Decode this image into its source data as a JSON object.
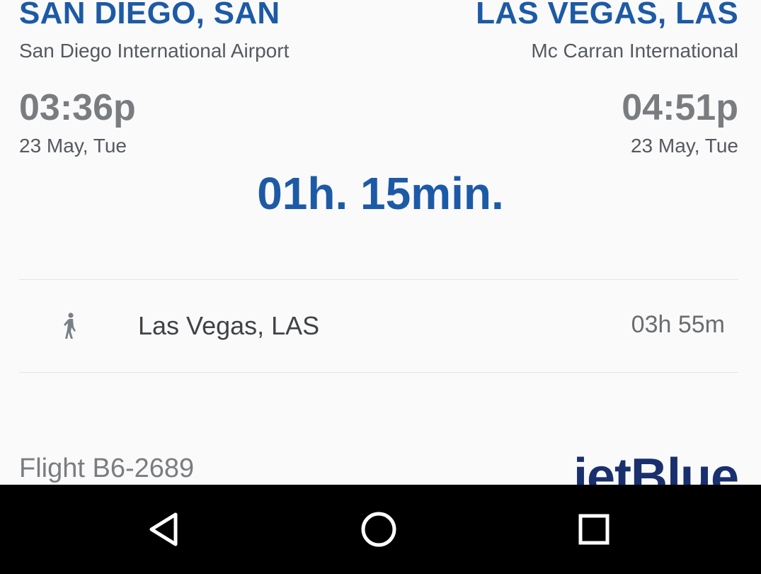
{
  "origin": {
    "city": "SAN DIEGO, SAN",
    "airport": "San Diego International Airport",
    "time": "03:36p",
    "date": "23 May, Tue"
  },
  "destination": {
    "city": "LAS VEGAS, LAS",
    "airport": "Mc Carran International",
    "time": "04:51p",
    "date": "23 May, Tue"
  },
  "duration": "01h. 15min.",
  "layover": {
    "icon": "walking-person-icon",
    "city": "Las Vegas, LAS",
    "time": "03h 55m"
  },
  "flight": {
    "number": "Flight B6-2689",
    "airline_logo": "jetBlue"
  },
  "navbar": {
    "back_icon": "back-triangle-icon",
    "home_icon": "home-circle-icon",
    "recents_icon": "recents-square-icon"
  },
  "colors": {
    "accent": "#1d5aa6",
    "time_gray": "#7a7d80",
    "airline": "#1a2f6e"
  }
}
